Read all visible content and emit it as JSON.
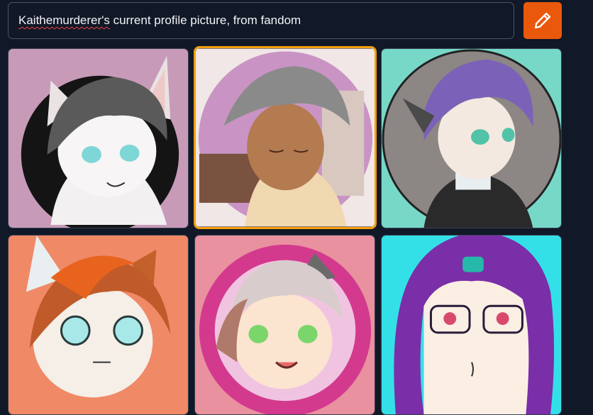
{
  "prompt": {
    "value_first_word": "Kaithemurderer's",
    "value_rest": " current profile picture, from fandom"
  },
  "generate_button": {
    "icon": "pencil-icon",
    "color": "#ea580c"
  },
  "accent_colors": {
    "selected_border": "#f59e0b"
  },
  "images": [
    {
      "bg": "#c79ab8",
      "selected": false
    },
    {
      "bg": "#f1e7e6",
      "selected": true
    },
    {
      "bg": "#78d8c8",
      "selected": false
    },
    {
      "bg": "#f08966",
      "selected": false
    },
    {
      "bg": "#e9919f",
      "selected": false
    },
    {
      "bg": "#34e0e8",
      "selected": false
    }
  ]
}
